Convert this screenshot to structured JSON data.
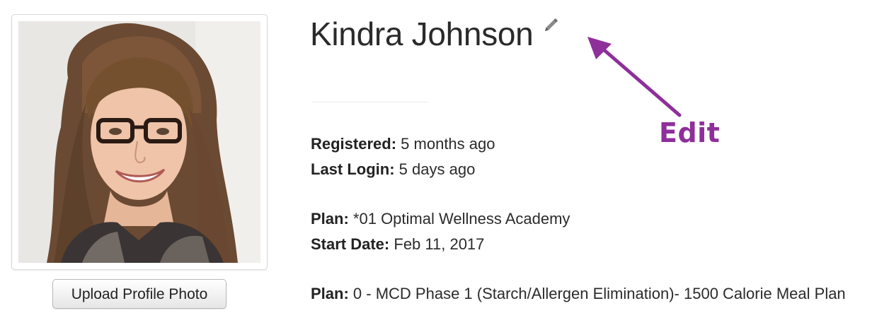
{
  "profile": {
    "name": "Kindra Johnson",
    "upload_button_label": "Upload Profile Photo",
    "edit_icon": "pencil-icon"
  },
  "details": {
    "registered_label": "Registered:",
    "registered_value": "5 months ago",
    "last_login_label": "Last Login:",
    "last_login_value": "5 days ago",
    "plan1_label": "Plan:",
    "plan1_value": "*01 Optimal Wellness Academy",
    "start_date_label": "Start Date:",
    "start_date_value": "Feb 11, 2017",
    "plan2_label": "Plan:",
    "plan2_value": "0 - MCD Phase 1 (Starch/Allergen Elimination)- 1500 Calorie Meal Plan"
  },
  "annotation": {
    "label": "Edit",
    "color": "#8e2f9a"
  }
}
